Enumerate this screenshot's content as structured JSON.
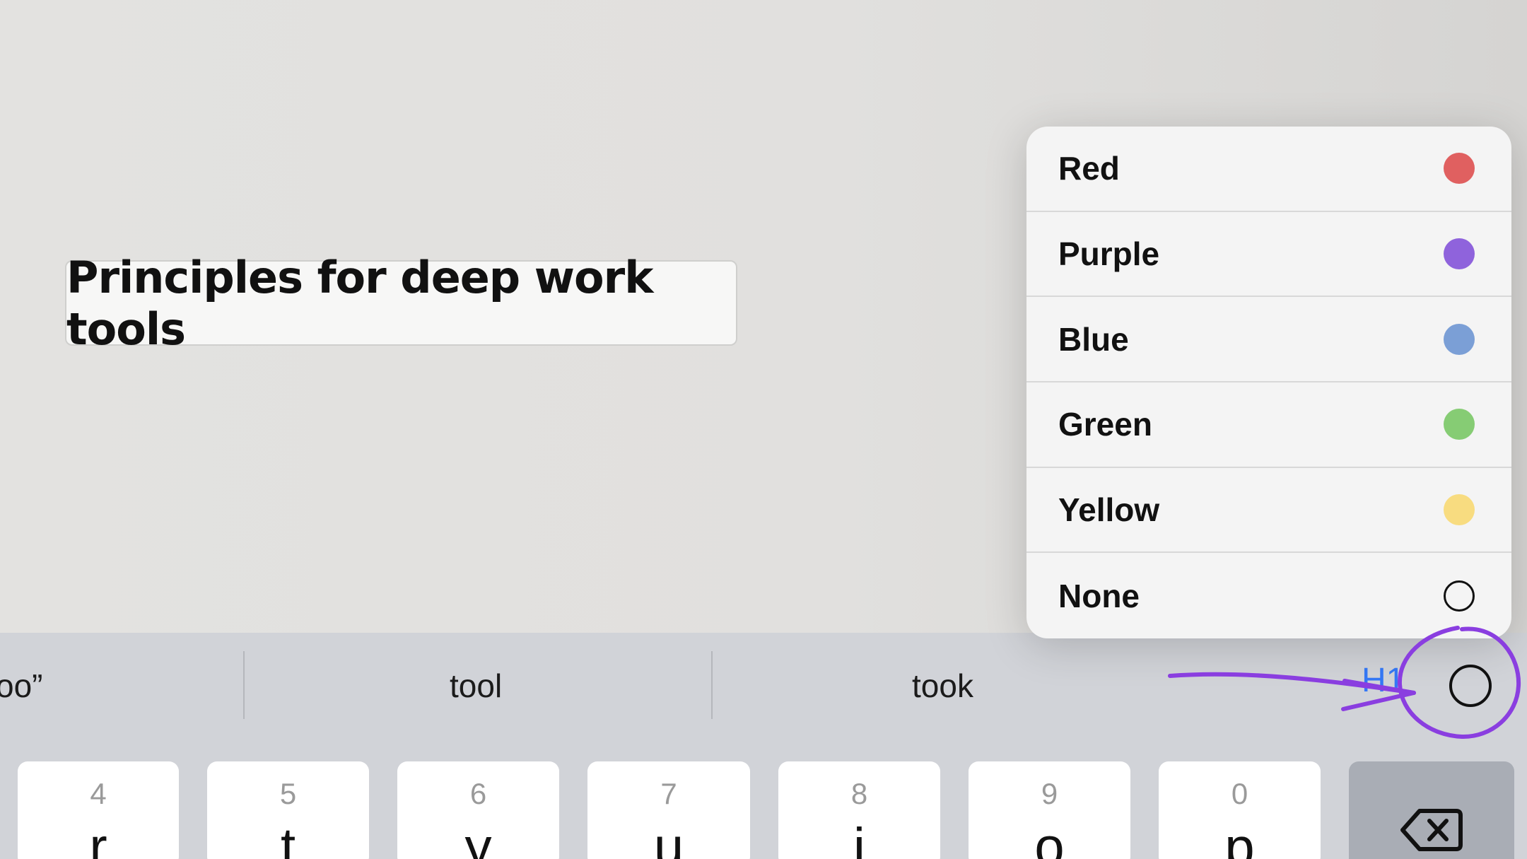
{
  "document": {
    "title": "Principles for deep work tools"
  },
  "color_menu": {
    "items": [
      {
        "label": "Red",
        "color": "#e06060"
      },
      {
        "label": "Purple",
        "color": "#8f63dc"
      },
      {
        "label": "Blue",
        "color": "#7b9fd6"
      },
      {
        "label": "Green",
        "color": "#86cc74"
      },
      {
        "label": "Yellow",
        "color": "#f8dc80"
      },
      {
        "label": "None",
        "color": "none"
      }
    ]
  },
  "keyboard": {
    "suggestions": [
      "oo”",
      "tool",
      "took"
    ],
    "h1_label": "H1",
    "keys": [
      {
        "num": "4",
        "letter": "r"
      },
      {
        "num": "5",
        "letter": "t"
      },
      {
        "num": "6",
        "letter": "y"
      },
      {
        "num": "7",
        "letter": "u"
      },
      {
        "num": "8",
        "letter": "i"
      },
      {
        "num": "9",
        "letter": "o"
      },
      {
        "num": "0",
        "letter": "p"
      }
    ]
  },
  "annotation": {
    "color": "#8a3ee0"
  }
}
